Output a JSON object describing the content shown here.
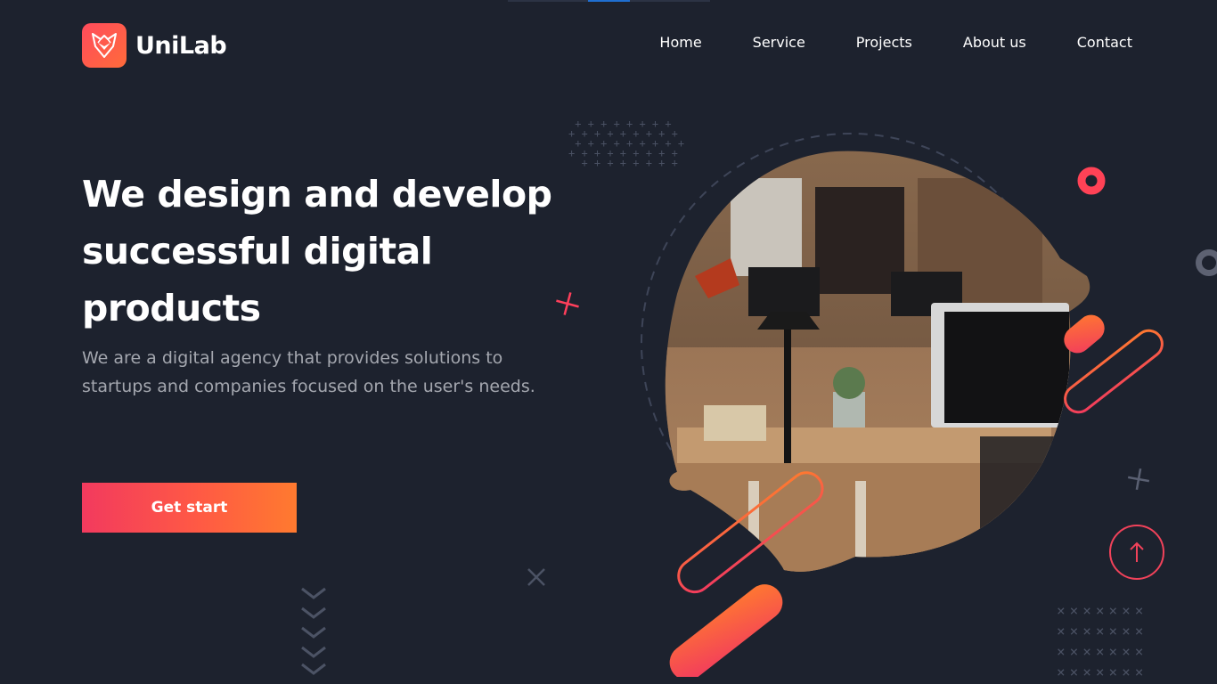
{
  "brand": {
    "name": "UniLab",
    "logo_icon": "fox-logo-icon",
    "logo_color": "#ff4b5c"
  },
  "nav": {
    "items": [
      {
        "label": "Home"
      },
      {
        "label": "Service"
      },
      {
        "label": "Projects"
      },
      {
        "label": "About us"
      },
      {
        "label": "Contact"
      }
    ]
  },
  "hero": {
    "title": "We design and develop successful digital products",
    "subtitle": "We are a digital agency that provides solutions to startups and companies focused on the user's needs.",
    "cta_label": "Get start"
  },
  "hero_image": {
    "icon": "office-workspace-photo"
  },
  "scroll_top": {
    "icon": "arrow-up-icon"
  },
  "colors": {
    "background": "#1d222e",
    "accent_start": "#f23a5e",
    "accent_end": "#ff7a2f",
    "muted_text": "#a4a7af"
  }
}
